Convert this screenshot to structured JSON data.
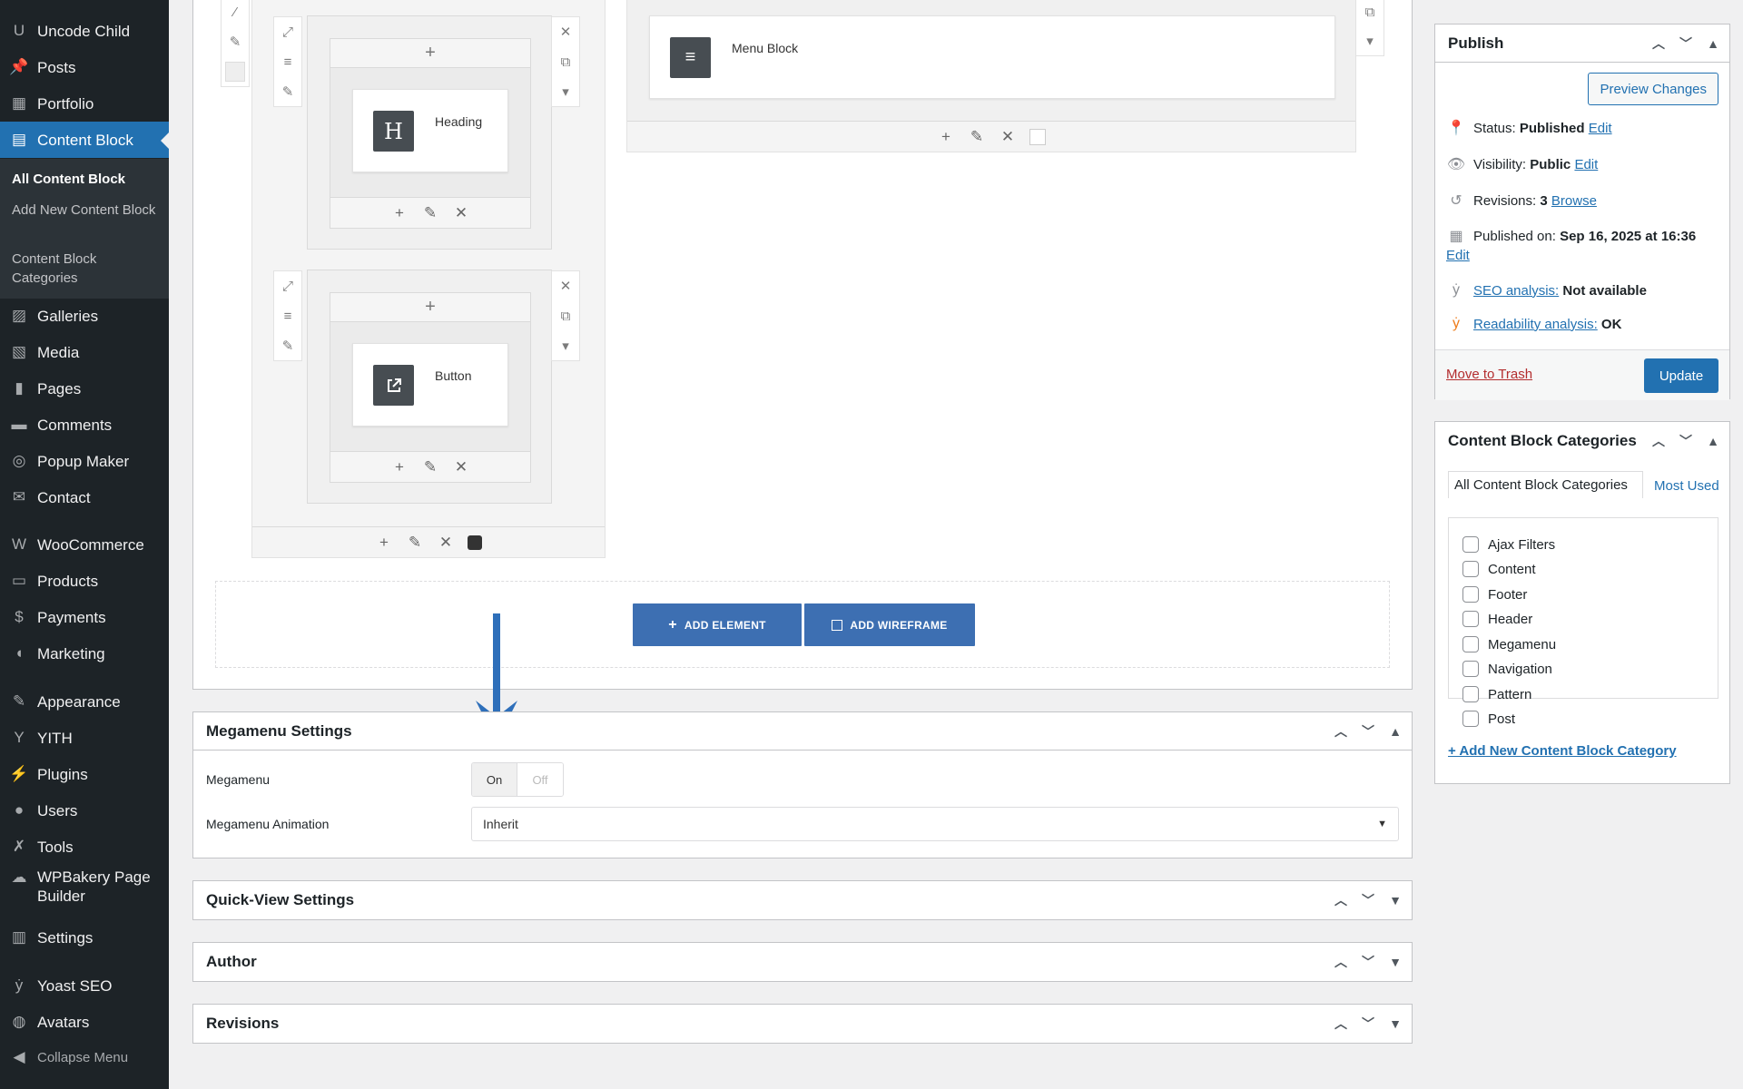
{
  "sidebar": {
    "items": [
      {
        "label": "Uncode Child",
        "icon": "uncode-icon"
      },
      {
        "label": "Posts",
        "icon": "pin-icon"
      },
      {
        "label": "Portfolio",
        "icon": "portfolio-icon"
      },
      {
        "label": "Content Block",
        "icon": "content-block-icon",
        "active": true
      },
      {
        "label": "Galleries",
        "icon": "gallery-icon"
      },
      {
        "label": "Media",
        "icon": "media-icon"
      },
      {
        "label": "Pages",
        "icon": "pages-icon"
      },
      {
        "label": "Comments",
        "icon": "comments-icon"
      },
      {
        "label": "Popup Maker",
        "icon": "popup-icon"
      },
      {
        "label": "Contact",
        "icon": "mail-icon"
      },
      {
        "label": "WooCommerce",
        "icon": "woocommerce-icon"
      },
      {
        "label": "Products",
        "icon": "products-icon"
      },
      {
        "label": "Payments",
        "icon": "payments-icon"
      },
      {
        "label": "Marketing",
        "icon": "megaphone-icon"
      },
      {
        "label": "Appearance",
        "icon": "brush-icon"
      },
      {
        "label": "YITH",
        "icon": "yith-icon"
      },
      {
        "label": "Plugins",
        "icon": "plugin-icon"
      },
      {
        "label": "Users",
        "icon": "user-icon"
      },
      {
        "label": "Tools",
        "icon": "wrench-icon"
      },
      {
        "label": "WPBakery Page Builder",
        "icon": "wpbakery-icon"
      },
      {
        "label": "Settings",
        "icon": "settings-icon"
      },
      {
        "label": "Yoast SEO",
        "icon": "yoast-icon"
      },
      {
        "label": "Avatars",
        "icon": "avatar-icon"
      }
    ],
    "submenu": [
      "All Content Block",
      "Add New Content Block",
      "Content Block Categories"
    ],
    "collapse": "Collapse Menu"
  },
  "builder": {
    "elements": {
      "heading": {
        "title": "Heading",
        "icon_letter": "H"
      },
      "button": {
        "title": "Button"
      },
      "menu_block": {
        "title": "Menu Block"
      }
    },
    "add_element": "ADD ELEMENT",
    "add_wireframe": "ADD WIREFRAME"
  },
  "megamenu": {
    "title": "Megamenu Settings",
    "megamenu_label": "Megamenu",
    "toggle_on": "On",
    "toggle_off": "Off",
    "animation_label": "Megamenu Animation",
    "animation_value": "Inherit"
  },
  "postboxes": {
    "quick_view": "Quick-View Settings",
    "author": "Author",
    "revisions": "Revisions"
  },
  "publish": {
    "title": "Publish",
    "preview": "Preview Changes",
    "status_label": "Status:",
    "status_value": "Published",
    "visibility_label": "Visibility:",
    "visibility_value": "Public",
    "revisions_label": "Revisions:",
    "revisions_value": "3",
    "browse": "Browse",
    "published_label": "Published on:",
    "published_value": "Sep 16, 2025 at 16:36",
    "edit": "Edit",
    "seo_link": "SEO analysis:",
    "seo_value": "Not available",
    "readability_link": "Readability analysis:",
    "readability_value": "OK",
    "trash": "Move to Trash",
    "update": "Update"
  },
  "categories": {
    "title": "Content Block Categories",
    "tab_all": "All Content Block Categories",
    "tab_most_used": "Most Used",
    "items": [
      "Ajax Filters",
      "Content",
      "Footer",
      "Header",
      "Megamenu",
      "Navigation",
      "Pattern",
      "Post"
    ],
    "add_new": "+ Add New Content Block Category"
  },
  "colors": {
    "admin_bar": "#1d2327",
    "accent": "#2271b1",
    "add_button": "#3d6fb2",
    "annotation_arrow": "#2e6fba"
  }
}
